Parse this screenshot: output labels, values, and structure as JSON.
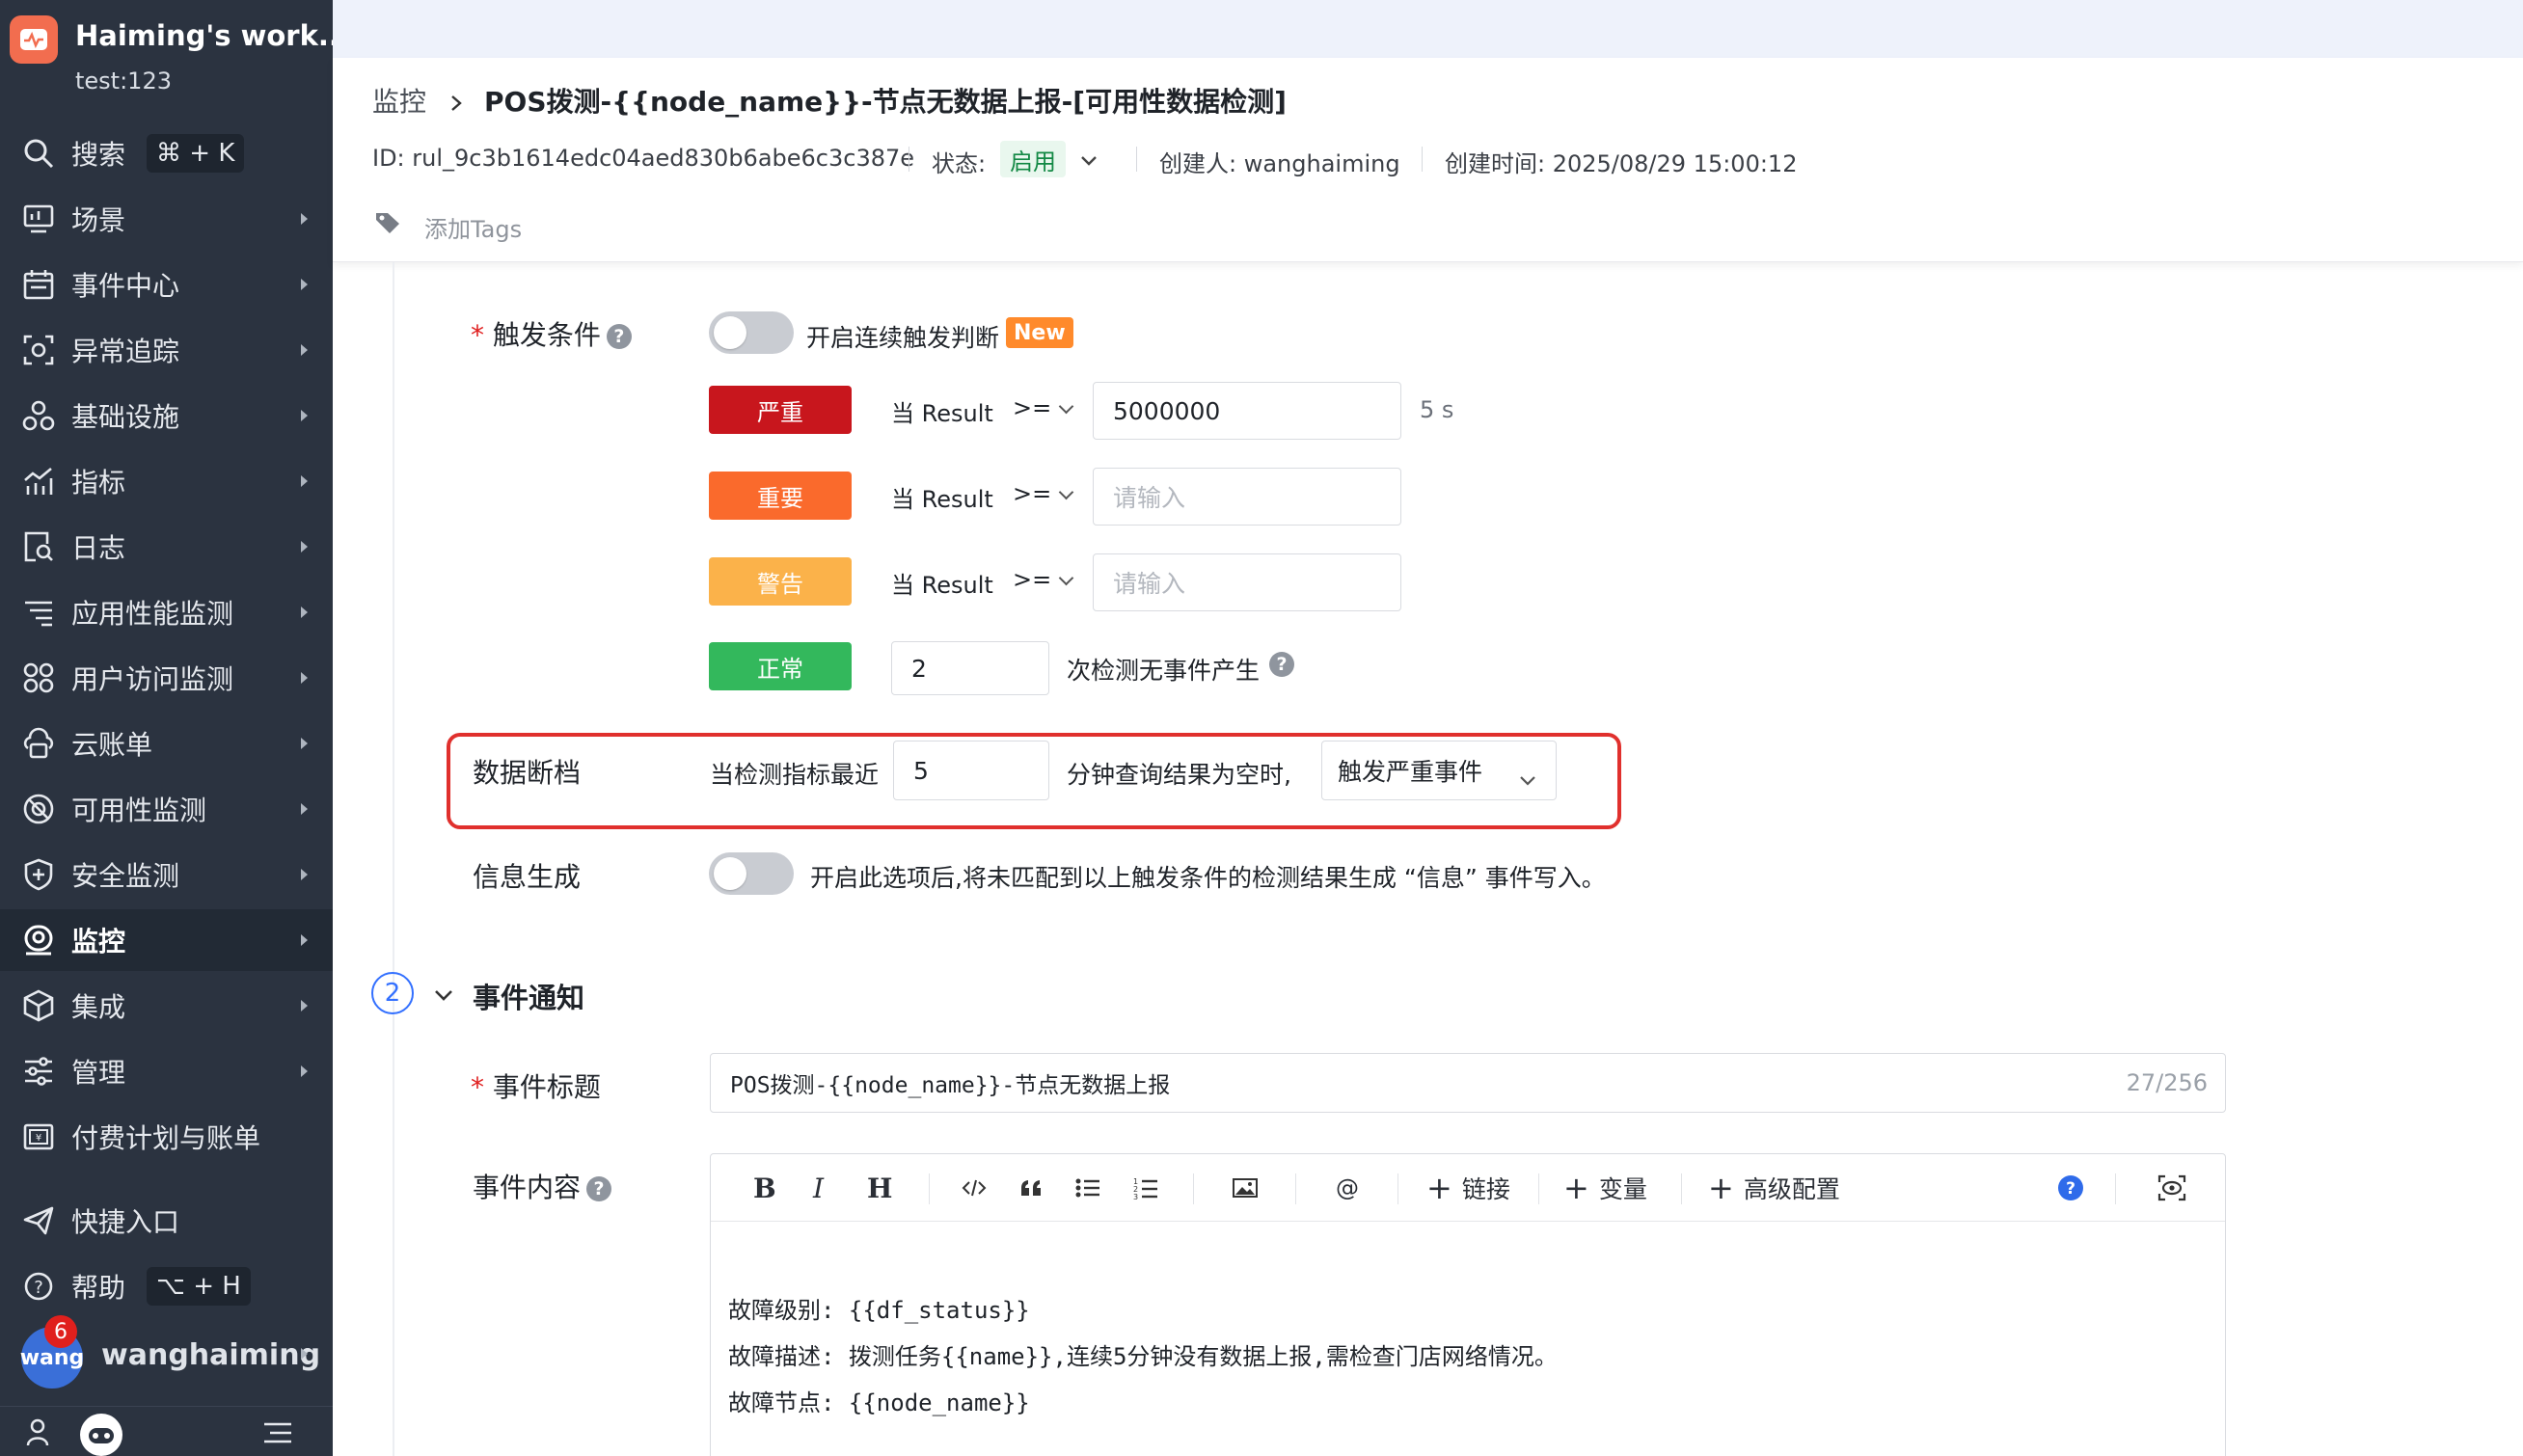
{
  "workspace": {
    "name": "Haiming's work...",
    "sub": "test:123"
  },
  "sidebar": {
    "search": {
      "label": "搜索",
      "shortcut": "⌘ + K"
    },
    "items": [
      {
        "label": "场景",
        "icon": "dashboard-icon"
      },
      {
        "label": "事件中心",
        "icon": "calendar-icon"
      },
      {
        "label": "异常追踪",
        "icon": "bug-scan-icon"
      },
      {
        "label": "基础设施",
        "icon": "infrastructure-icon"
      },
      {
        "label": "指标",
        "icon": "metrics-chart-icon"
      },
      {
        "label": "日志",
        "icon": "log-search-icon"
      },
      {
        "label": "应用性能监测",
        "icon": "apm-list-icon"
      },
      {
        "label": "用户访问监测",
        "icon": "rum-grid-icon"
      },
      {
        "label": "云账单",
        "icon": "cloud-bill-icon"
      },
      {
        "label": "可用性监测",
        "icon": "dial-test-icon"
      },
      {
        "label": "安全监测",
        "icon": "shield-icon"
      },
      {
        "label": "监控",
        "icon": "monitor-icon",
        "active": true
      },
      {
        "label": "集成",
        "icon": "cube-icon"
      },
      {
        "label": "管理",
        "icon": "sliders-icon"
      },
      {
        "label": "付费计划与账单",
        "icon": "billing-icon"
      }
    ],
    "quick_entry": "快捷入口",
    "help": {
      "label": "帮助",
      "shortcut": "⌥ + H"
    },
    "user": {
      "avatar": "wang",
      "name": "wanghaiming",
      "badge": "6"
    }
  },
  "header": {
    "breadcrumb_root": "监控",
    "title": "POS拨测-{{node_name}}-节点无数据上报-[可用性数据检测]",
    "id_text": "ID: rul_9c3b1614edc04aed830b6abe6c3c387e",
    "status_label": "状态:",
    "status_value": "启用",
    "creator": "创建人: wanghaiming",
    "created_at": "创建时间: 2025/08/29 15:00:12",
    "add_tags": "添加Tags"
  },
  "trigger": {
    "label": "触发条件",
    "continuous_label": "开启连续触发判断",
    "new_badge": "New",
    "rows": [
      {
        "level": "严重",
        "color": "#c8161d",
        "prefix": "当 Result",
        "op": ">=",
        "value": "5000000",
        "placeholder": "",
        "suffix": "5 s"
      },
      {
        "level": "重要",
        "color": "#fa6a2c",
        "prefix": "当 Result",
        "op": ">=",
        "value": "",
        "placeholder": "请输入",
        "suffix": ""
      },
      {
        "level": "警告",
        "color": "#fbb24a",
        "prefix": "当 Result",
        "op": ">=",
        "value": "",
        "placeholder": "请输入",
        "suffix": ""
      }
    ],
    "normal": {
      "level": "正常",
      "color": "#33b85c",
      "value": "2",
      "suffix": "次检测无事件产生"
    }
  },
  "data_gap": {
    "label": "数据断档",
    "prefix": "当检测指标最近",
    "value": "5",
    "middle": "分钟查询结果为空时,",
    "action": "触发严重事件"
  },
  "info_gen": {
    "label": "信息生成",
    "desc": "开启此选项后,将未匹配到以上触发条件的检测结果生成 “信息” 事件写入。"
  },
  "notify": {
    "step": "2",
    "title": "事件通知",
    "event_title_label": "事件标题",
    "event_title_value": "POS拨测-{{node_name}}-节点无数据上报",
    "event_title_count": "27/256",
    "content_label": "事件内容",
    "toolbar": {
      "link": "链接",
      "variable": "变量",
      "advanced": "高级配置"
    },
    "content_lines": [
      "故障级别: {{df_status}}",
      "故障描述: 拨测任务{{name}},连续5分钟没有数据上报,需检查门店网络情况。",
      "故障节点: {{node_name}}"
    ]
  }
}
